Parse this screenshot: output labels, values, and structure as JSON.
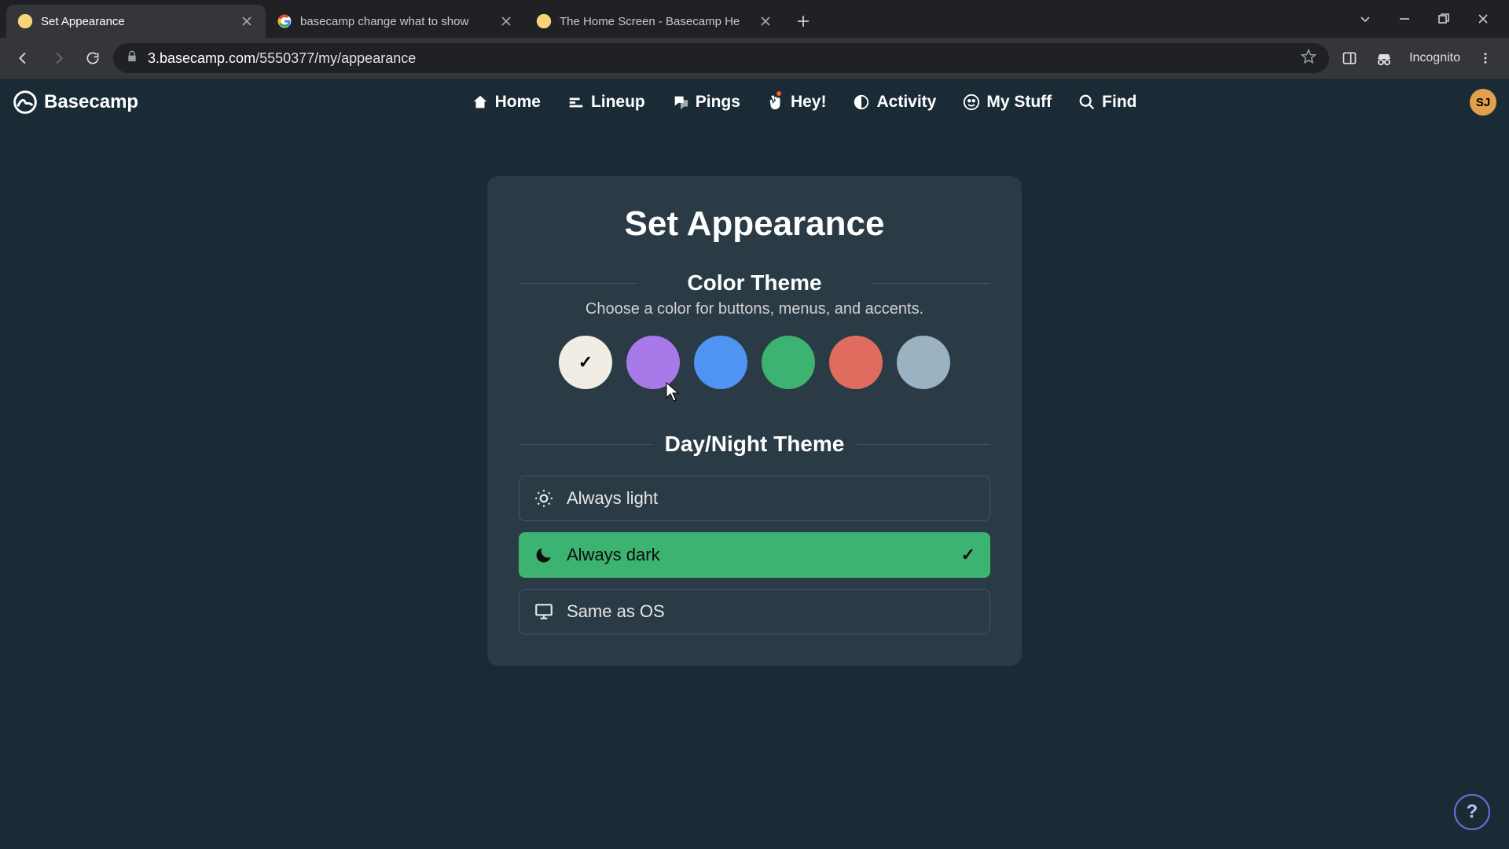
{
  "browser": {
    "tabs": [
      {
        "title": "Set Appearance",
        "active": true
      },
      {
        "title": "basecamp change what to show",
        "active": false
      },
      {
        "title": "The Home Screen - Basecamp He",
        "active": false
      }
    ],
    "url_host": "3.basecamp.com",
    "url_path": "/5550377/my/appearance",
    "incognito_label": "Incognito"
  },
  "header": {
    "brand": "Basecamp",
    "nav": {
      "home": "Home",
      "lineup": "Lineup",
      "pings": "Pings",
      "hey": "Hey!",
      "activity": "Activity",
      "mystuff": "My Stuff",
      "find": "Find"
    },
    "avatar_initials": "SJ"
  },
  "panel": {
    "title": "Set Appearance",
    "color_section": {
      "heading": "Color Theme",
      "description": "Choose a color for buttons, menus, and accents.",
      "swatches": [
        {
          "name": "default",
          "color": "#f1ede4",
          "selected": true
        },
        {
          "name": "purple",
          "color": "#a779e9",
          "selected": false
        },
        {
          "name": "blue",
          "color": "#4f94f2",
          "selected": false
        },
        {
          "name": "green",
          "color": "#3cb371",
          "selected": false
        },
        {
          "name": "red",
          "color": "#e06c60",
          "selected": false
        },
        {
          "name": "slate",
          "color": "#9bb2c2",
          "selected": false
        }
      ]
    },
    "daynight_section": {
      "heading": "Day/Night Theme",
      "options": {
        "light": "Always light",
        "dark": "Always dark",
        "os": "Same as OS"
      },
      "selected": "dark"
    }
  },
  "help_label": "?"
}
